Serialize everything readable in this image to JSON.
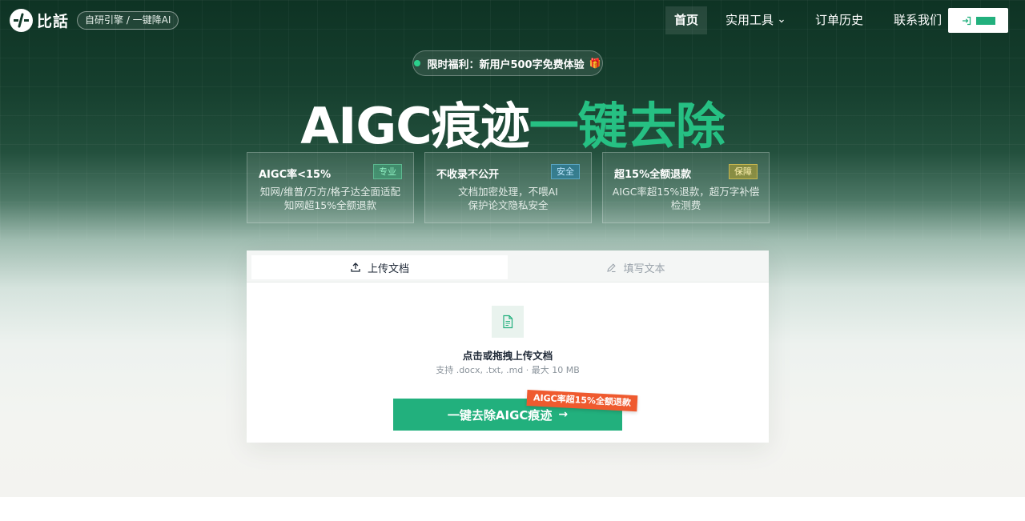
{
  "header": {
    "logo_text": "比話",
    "logo_badge": "自研引擎 / 一键降AI",
    "nav": {
      "home": "首页",
      "tools": "实用工具",
      "orders": "订单历史",
      "contact": "联系我们"
    }
  },
  "hero": {
    "promo": "限时福利：新用户500字免费体验",
    "promo_icon": "gift-icon",
    "title_white": "AIGC痕迹",
    "title_green": "一键去除",
    "accent_color": "#26c083"
  },
  "features": [
    {
      "title": "AIGC率<15%",
      "tag": "专业",
      "line1": "知网/维普/万方/格子达全面适配",
      "line2": "知网超15%全额退款"
    },
    {
      "title": "不收录不公开",
      "tag": "安全",
      "line1": "文档加密处理，不喂AI",
      "line2": "保护论文隐私安全"
    },
    {
      "title": "超15%全额退款",
      "tag": "保障",
      "line1": "AIGC率超15%退款，超万字补偿",
      "line2": "检测费"
    }
  ],
  "upload": {
    "tab_upload": "上传文档",
    "tab_write": "填写文本",
    "drop_title": "点击或拖拽上传文档",
    "drop_sub": "支持 .docx, .txt, .md · 最大 10 MB",
    "cta_label": "一键去除AIGC痕迹",
    "cta_arrow": "→",
    "ribbon": "AIGC率超15%全额退款",
    "cta_color": "#22b07d",
    "ribbon_color": "#ef5a2f"
  }
}
